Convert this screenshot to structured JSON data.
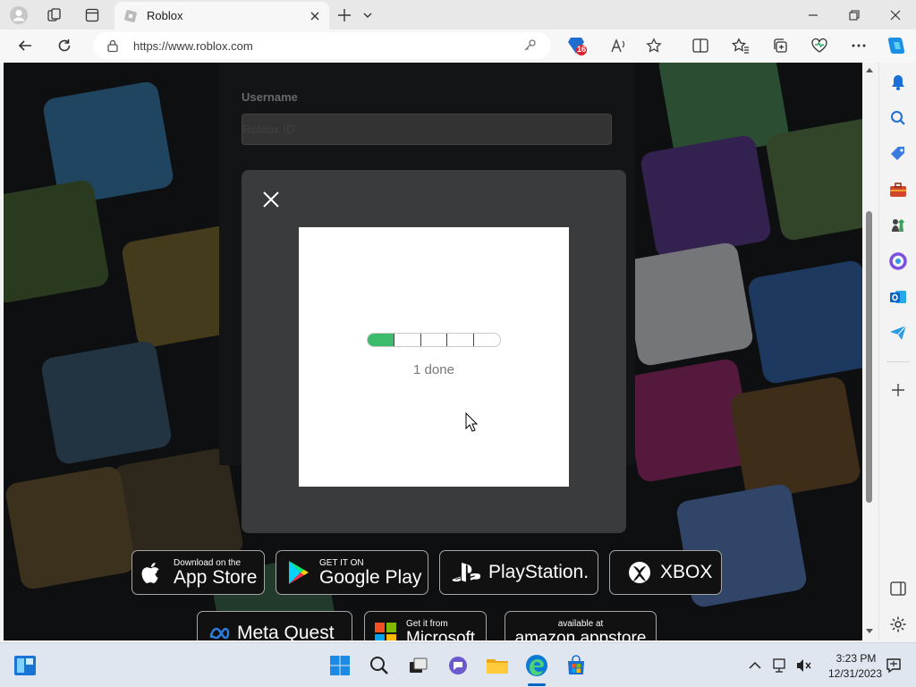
{
  "browser": {
    "tab_title": "Roblox",
    "url": "https://www.roblox.com",
    "extension_badge": "16"
  },
  "page": {
    "username_label": "Username",
    "username_placeholder": "Roblox ID"
  },
  "captcha": {
    "progress_text": "1 done",
    "steps_total": 5,
    "steps_done": 1,
    "progress_color": "#3dbb6c"
  },
  "store_badges": [
    {
      "small": "Download on the",
      "big": "App Store"
    },
    {
      "small": "GET IT ON",
      "big": "Google Play"
    },
    {
      "small": "",
      "big": "PlayStation."
    },
    {
      "small": "",
      "big": "XBOX"
    },
    {
      "small": "",
      "big": "Meta Quest"
    },
    {
      "small": "Get it from",
      "big": "Microsoft"
    },
    {
      "small": "available at",
      "big": "amazon appstore"
    }
  ],
  "taskbar": {
    "time": "3:23 PM",
    "date": "12/31/2023"
  },
  "colors": {
    "edge_accent": "#0a7bd6",
    "roblox_bg": "#232527"
  }
}
